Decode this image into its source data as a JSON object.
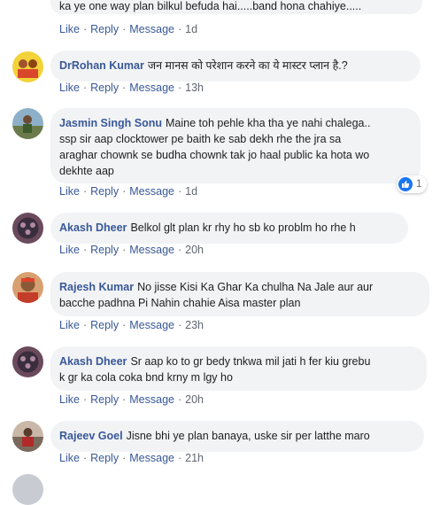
{
  "actions": {
    "like": "Like",
    "reply": "Reply",
    "message": "Message",
    "sep": "·"
  },
  "colors": {
    "author": "#385898",
    "bubble": "#f2f3f5",
    "meta": "#606770",
    "like_blue": "#1877f2"
  },
  "comments": [
    {
      "author": "",
      "text": "ka ye one way plan bilkul befuda hai.....band hona chahiye.....",
      "time": "1d"
    },
    {
      "author": "DrRohan Kumar",
      "text": "जन मानस को परेशान करने का ये मास्टर प्लान है.?",
      "time": "13h"
    },
    {
      "author": "Jasmin Singh Sonu",
      "text_line1": "Maine toh pehle kha tha ye nahi chalega..",
      "text_line2": "ssp sir aap clocktower pe baith ke sab dekh rhe the jra sa",
      "text_line3": "araghar chownk se budha chownk tak jo haal public ka hota wo",
      "text_line4": "dekhte aap",
      "time": "1d",
      "reaction_count": "1",
      "reaction_icon": "like-thumb-icon"
    },
    {
      "author": "Akash Dheer",
      "text": "Belkol glt plan kr rhy ho sb ko problm ho rhe h",
      "time": "20h"
    },
    {
      "author": "Rajesh Kumar",
      "text_line1": "No jisse Kisi Ka Ghar Ka chulha Na Jale aur aur",
      "text_line2": "bacche padhna Pi Nahin chahie Aisa master plan",
      "time": "23h"
    },
    {
      "author": "Akash Dheer",
      "text_line1": "Sr aap ko to gr bedy tnkwa mil jati h fer kiu grebu",
      "text_line2": "k gr ka cola coka bnd krny m lgy ho",
      "time": "20h"
    },
    {
      "author": "Rajeev Goel",
      "text": "Jisne bhi ye plan banaya, uske sir per latthe maro",
      "time": "21h"
    }
  ]
}
